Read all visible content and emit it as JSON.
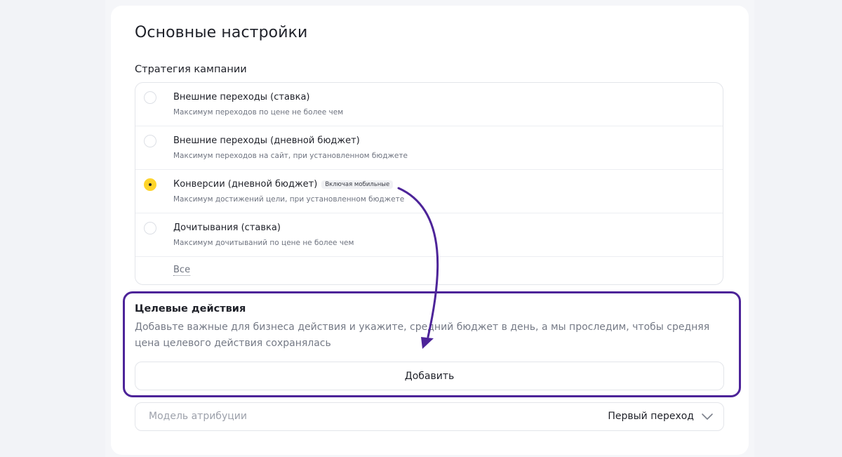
{
  "page": {
    "title": "Основные настройки"
  },
  "strategy": {
    "label": "Стратегия кампании",
    "options": [
      {
        "title": "Внешние переходы (ставка)",
        "subtitle": "Максимум переходов по цене не более чем",
        "selected": false
      },
      {
        "title": "Внешние переходы (дневной бюджет)",
        "subtitle": "Максимум переходов на сайт, при установленном бюджете",
        "selected": false
      },
      {
        "title": "Конверсии (дневной бюджет)",
        "badge": "Включая мобильные",
        "subtitle": "Максимум достижений цели, при установленном бюджете",
        "selected": true
      },
      {
        "title": "Дочитывания (ставка)",
        "subtitle": "Максимум дочитываний по цене не более чем",
        "selected": false
      }
    ],
    "all_link": "Все"
  },
  "target_actions": {
    "title": "Целевые действия",
    "description": "Добавьте важные для бизнеса действия и укажите, средний бюджет в день, а мы проследим, чтобы средняя цена целевого действия сохранялась",
    "add_button": "Добавить"
  },
  "attribution": {
    "label": "Модель атрибуции",
    "value": "Первый переход"
  },
  "colors": {
    "accent_radio": "#fed42b",
    "highlight_frame": "#4d2499",
    "page_background": "#f2f3f7"
  }
}
